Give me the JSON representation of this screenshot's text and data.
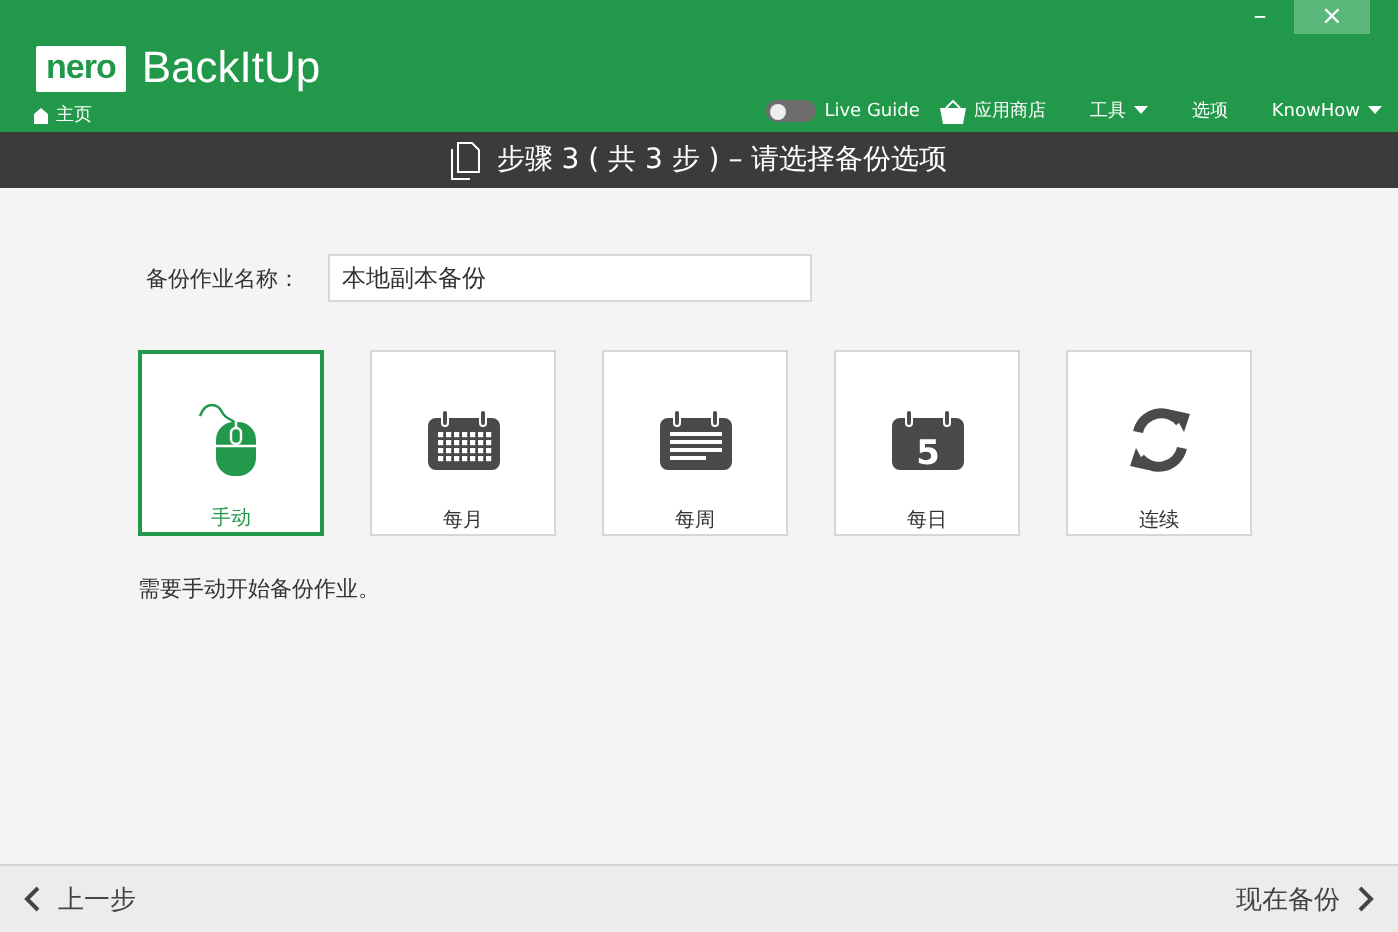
{
  "header": {
    "logo": "nero",
    "product": "BackItUp",
    "home": "主页",
    "window_buttons": [
      "–",
      "×"
    ],
    "live_guide": {
      "label": "Live Guide",
      "on": false
    },
    "nav": [
      {
        "label": "应用商店",
        "kind": "store",
        "dropdown": false
      },
      {
        "label": "工具",
        "kind": "menu",
        "dropdown": true
      },
      {
        "label": "选项",
        "kind": "menu",
        "dropdown": false
      },
      {
        "label": "KnowHow",
        "kind": "menu",
        "dropdown": true
      }
    ]
  },
  "step_bar": {
    "title": "步骤 3 ( 共 3 步 ) – 请选择备份选项"
  },
  "job_name": {
    "label": "备份作业名称：",
    "value": "本地副本备份"
  },
  "options": [
    {
      "label": "手动",
      "kind": "mouse",
      "selected": true
    },
    {
      "label": "每月",
      "kind": "month",
      "selected": false
    },
    {
      "label": "每周",
      "kind": "week",
      "selected": false
    },
    {
      "label": "每日",
      "kind": "day",
      "badge": "5",
      "selected": false
    },
    {
      "label": "连续",
      "kind": "continuous",
      "selected": false
    }
  ],
  "description": "需要手动开始备份作业。",
  "footer": {
    "back": "上一步",
    "next": "现在备份"
  }
}
